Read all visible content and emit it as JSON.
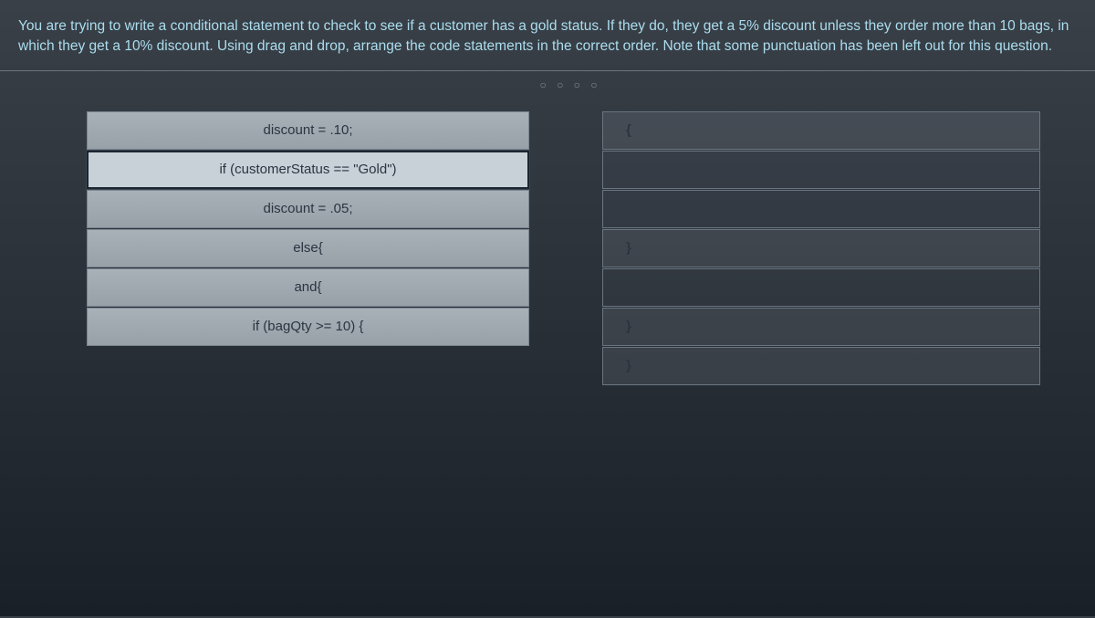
{
  "question": {
    "prompt": "You are trying to write a conditional statement to check to see if a customer has a gold status. If they do, they get a 5% discount unless they order more than 10 bags, in which they get a 10% discount. Using drag and drop, arrange the code statements in the correct order. Note that some punctuation has been left out for this question."
  },
  "ticks": "○ ○ ○ ○",
  "source_blocks": [
    {
      "label": "discount = .10;",
      "selected": false
    },
    {
      "label": "if (customerStatus == \"Gold\")",
      "selected": true
    },
    {
      "label": "discount = .05;",
      "selected": false
    },
    {
      "label": "else{",
      "selected": false
    },
    {
      "label": "and{",
      "selected": false
    },
    {
      "label": "if (bagQty >= 10) {",
      "selected": false
    }
  ],
  "target_slots": [
    {
      "content": "{"
    },
    {
      "content": ""
    },
    {
      "content": ""
    },
    {
      "content": "}"
    },
    {
      "content": ""
    },
    {
      "content": "}"
    },
    {
      "content": "}"
    }
  ]
}
